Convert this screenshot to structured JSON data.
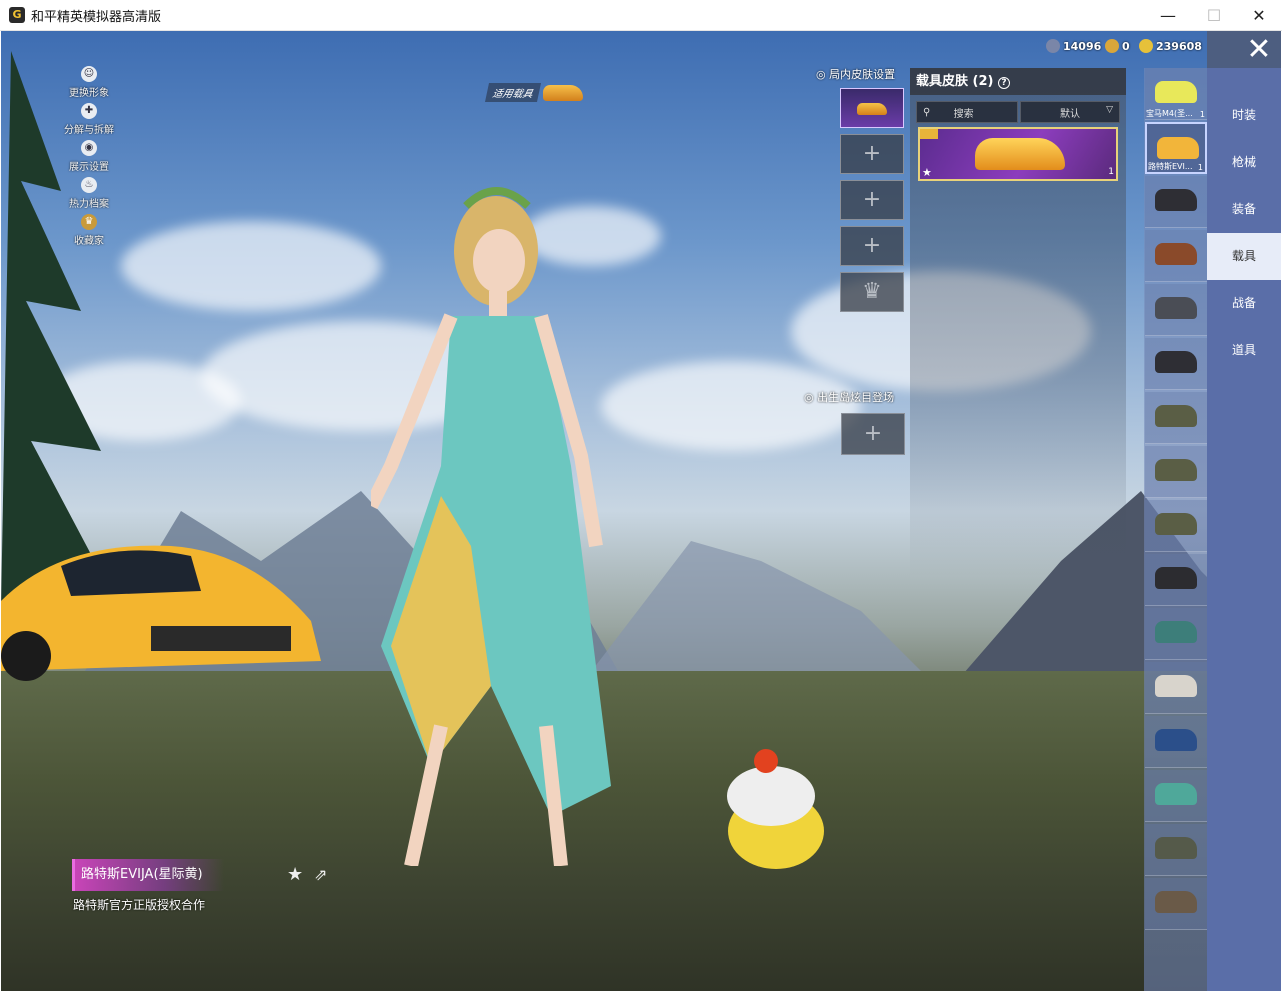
{
  "window": {
    "title": "和平精英模拟器高清版",
    "app_icon_glyph": "G",
    "min_glyph": "—",
    "max_glyph": "☐",
    "close_glyph": "✕"
  },
  "left_menu": [
    {
      "label": "更换形象",
      "icon": "avatar-icon"
    },
    {
      "label": "分解与拆解",
      "icon": "puzzle-icon"
    },
    {
      "label": "展示设置",
      "icon": "eye-icon"
    },
    {
      "label": "热力档案",
      "icon": "flame-icon"
    },
    {
      "label": "收藏家",
      "icon": "collector-badge-icon"
    }
  ],
  "currency": [
    {
      "icon": "moon-coin-icon",
      "value": "14096",
      "color": "#7a86a8"
    },
    {
      "icon": "gold-badge-icon",
      "value": "0",
      "color": "#d9a63a"
    },
    {
      "icon": "gold-coin-icon",
      "value": "239608",
      "color": "#e6c13a"
    }
  ],
  "close_button_glyph": "✕",
  "apply_vehicle": {
    "label": "适用载具"
  },
  "in_game_skin": {
    "header": "局内皮肤设置",
    "plus_glyph": "+",
    "crown_glyph": "♛"
  },
  "spawn_island": {
    "header": "出生岛炫目登场",
    "plus_glyph": "+"
  },
  "skin_panel": {
    "title": "载具皮肤 (2)",
    "help_glyph": "?",
    "search_label": "搜索",
    "sort_value": "默认",
    "card_count": "1",
    "star_glyph": "★"
  },
  "vehicles": [
    {
      "label": "宝马M4(圣...",
      "count": "1",
      "color": "#e8e85a",
      "active": false
    },
    {
      "label": "路特斯EVI...",
      "count": "1",
      "color": "#f2b53a",
      "active": true
    },
    {
      "label": "",
      "count": "",
      "color": "#2e2e34",
      "active": false
    },
    {
      "label": "",
      "count": "",
      "color": "#8a4a2a",
      "active": false
    },
    {
      "label": "",
      "count": "",
      "color": "#4a4d55",
      "active": false
    },
    {
      "label": "",
      "count": "",
      "color": "#2e2e34",
      "active": false
    },
    {
      "label": "",
      "count": "",
      "color": "#5a5e45",
      "active": false
    },
    {
      "label": "",
      "count": "",
      "color": "#5a5e45",
      "active": false
    },
    {
      "label": "",
      "count": "",
      "color": "#5a5e45",
      "active": false
    },
    {
      "label": "",
      "count": "",
      "color": "#2c2c30",
      "active": false
    },
    {
      "label": "",
      "count": "",
      "color": "#3d7e7a",
      "active": false
    },
    {
      "label": "",
      "count": "",
      "color": "#d8d4cc",
      "active": false
    },
    {
      "label": "",
      "count": "",
      "color": "#2b4f8a",
      "active": false
    },
    {
      "label": "",
      "count": "",
      "color": "#4fa89a",
      "active": false
    },
    {
      "label": "",
      "count": "",
      "color": "#555a4a",
      "active": false
    },
    {
      "label": "",
      "count": "",
      "color": "#6a5a48",
      "active": false
    }
  ],
  "categories": [
    {
      "label": "时装",
      "active": false
    },
    {
      "label": "枪械",
      "active": false
    },
    {
      "label": "装备",
      "active": false
    },
    {
      "label": "载具",
      "active": true
    },
    {
      "label": "战备",
      "active": false
    },
    {
      "label": "道具",
      "active": false
    }
  ],
  "selected_item": {
    "name": "路特斯EVIJA(星际黄)",
    "description": "路特斯官方正版授权合作",
    "star_glyph": "★",
    "share_glyph": "⇗"
  }
}
